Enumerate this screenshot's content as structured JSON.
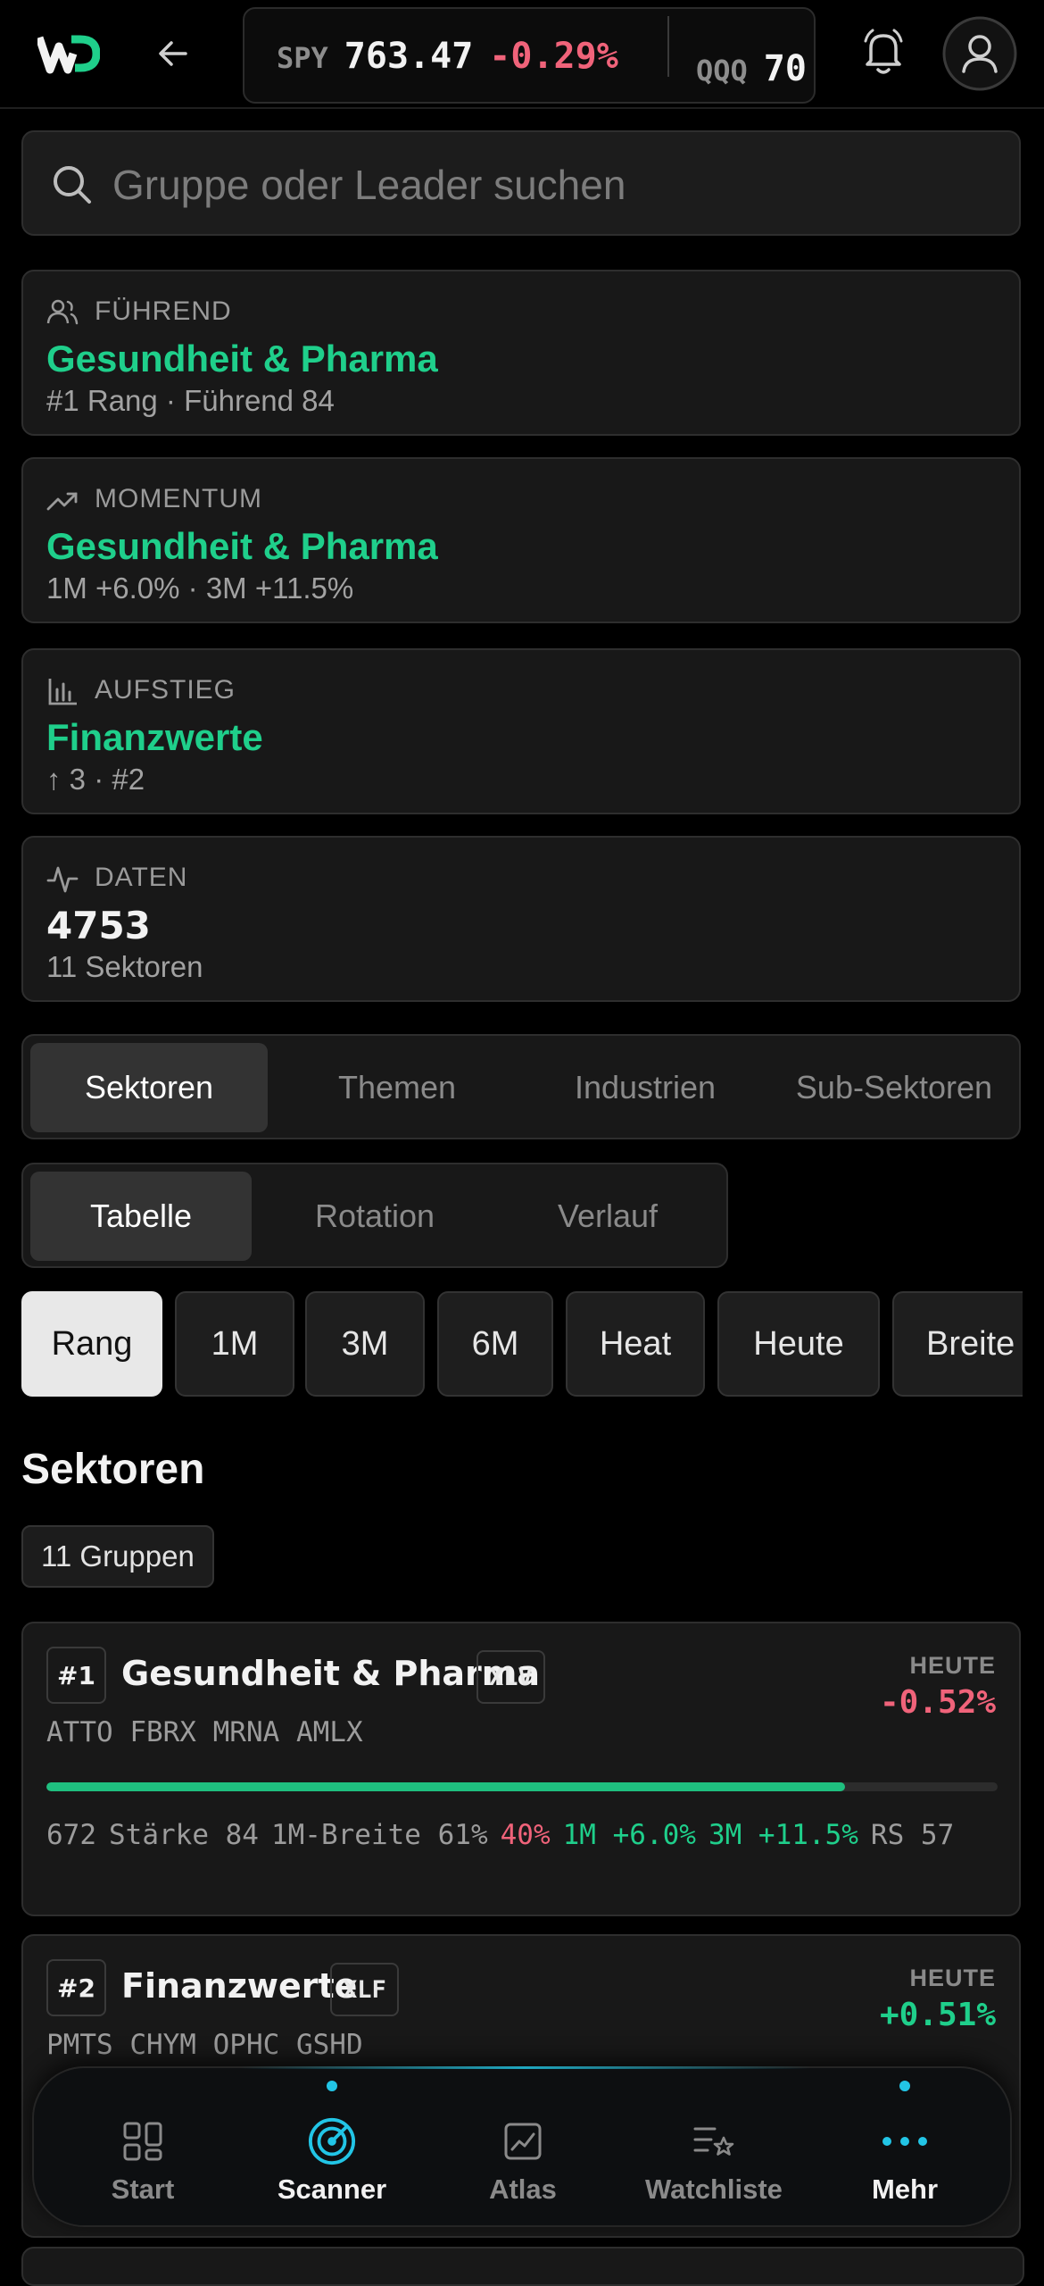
{
  "header": {
    "logo_text": "WD",
    "tickers": [
      {
        "symbol": "SPY",
        "price": "763.47",
        "change": "-0.29%"
      },
      {
        "symbol": "QQQ",
        "price": "70"
      }
    ]
  },
  "search": {
    "placeholder": "Gruppe oder Leader suchen",
    "value": ""
  },
  "summary_cards": [
    {
      "label": "FÜHREND",
      "icon": "users-icon",
      "title": "Gesundheit & Pharma",
      "subtitle": "#1 Rang · Führend 84"
    },
    {
      "label": "MOMENTUM",
      "icon": "trending-up-icon",
      "title": "Gesundheit & Pharma",
      "subtitle": "1M +6.0% · 3M +11.5%"
    },
    {
      "label": "AUFSTIEG",
      "icon": "bar-chart-icon",
      "title": "Finanzwerte",
      "subtitle": "↑ 3 · #2"
    },
    {
      "label": "DATEN",
      "icon": "activity-icon",
      "title": "4753",
      "subtitle": "11 Sektoren"
    }
  ],
  "group_tabs": [
    "Sektoren",
    "Themen",
    "Industrien",
    "Sub-Sektoren"
  ],
  "group_tab_active": "Sektoren",
  "view_tabs": [
    "Tabelle",
    "Rotation",
    "Verlauf"
  ],
  "view_tab_active": "Tabelle",
  "sort_chips": [
    "Rang",
    "1M",
    "3M",
    "6M",
    "Heat",
    "Heute",
    "Breite"
  ],
  "sort_active": "Rang",
  "section": {
    "title": "Sektoren",
    "count_label": "11 Gruppen"
  },
  "sectors": [
    {
      "rank": "#1",
      "name": "Gesundheit & Pharma",
      "etf": "XLV",
      "today_label": "HEUTE",
      "today": "-0.52%",
      "leaders": "ATTO FBRX MRNA AMLX",
      "strength_fraction": 0.84,
      "metrics": {
        "count": "672",
        "strength": "Stärke 84",
        "breadth": "1M-Breite 61%",
        "pct": "40%",
        "m1": "1M +6.0%",
        "m3": "3M +11.5%",
        "rs": "RS 57"
      }
    },
    {
      "rank": "#2",
      "name": "Finanzwerte",
      "etf": "XLF",
      "today_label": "HEUTE",
      "today": "+0.51%",
      "leaders": "PMTS CHYM OPHC GSHD"
    }
  ],
  "nav": [
    {
      "label": "Start",
      "icon": "grid-icon"
    },
    {
      "label": "Scanner",
      "icon": "radar-icon"
    },
    {
      "label": "Atlas",
      "icon": "chart-icon"
    },
    {
      "label": "Watchliste",
      "icon": "watchlist-icon"
    },
    {
      "label": "Mehr",
      "icon": "more-icon"
    }
  ],
  "nav_active": "Scanner",
  "colors": {
    "accent_green": "#1fcf8b",
    "negative_red": "#f0637a",
    "nav_cyan": "#22c5e6"
  }
}
